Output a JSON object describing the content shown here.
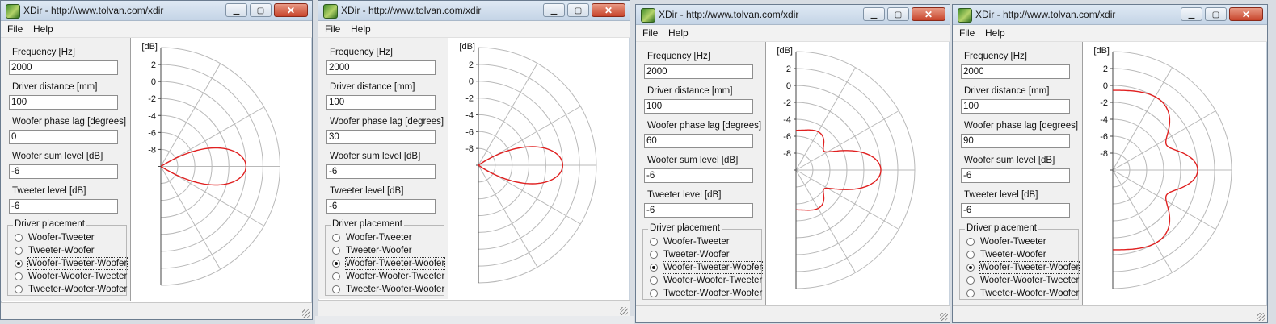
{
  "title": "XDir - http://www.tolvan.com/xdir",
  "menu": [
    "File",
    "Help"
  ],
  "title_buttons": [
    "minimize",
    "maximize",
    "close"
  ],
  "labels": {
    "frequency": "Frequency [Hz]",
    "distance": "Driver distance [mm]",
    "phase": "Woofer phase lag [degrees]",
    "woofer_level": "Woofer sum level [dB]",
    "tweeter_level": "Tweeter level [dB]",
    "placement": "Driver placement"
  },
  "placements": [
    "Woofer-Tweeter",
    "Tweeter-Woofer",
    "Woofer-Tweeter-Woofer",
    "Woofer-Woofer-Tweeter",
    "Tweeter-Woofer-Woofer"
  ],
  "plot_unit": "[dB]",
  "plot_ticks": [
    "2",
    "0",
    "-2",
    "-4",
    "-6",
    "-8"
  ],
  "curve_color": "#e02020",
  "windows": [
    {
      "frequency": "2000",
      "distance": "100",
      "phase": "0",
      "woofer_level": "-6",
      "tweeter_level": "-6",
      "selected": 2
    },
    {
      "frequency": "2000",
      "distance": "100",
      "phase": "30",
      "woofer_level": "-6",
      "tweeter_level": "-6",
      "selected": 2
    },
    {
      "frequency": "2000",
      "distance": "100",
      "phase": "60",
      "woofer_level": "-6",
      "tweeter_level": "-6",
      "selected": 2
    },
    {
      "frequency": "2000",
      "distance": "100",
      "phase": "90",
      "woofer_level": "-6",
      "tweeter_level": "-6",
      "selected": 2
    }
  ]
}
